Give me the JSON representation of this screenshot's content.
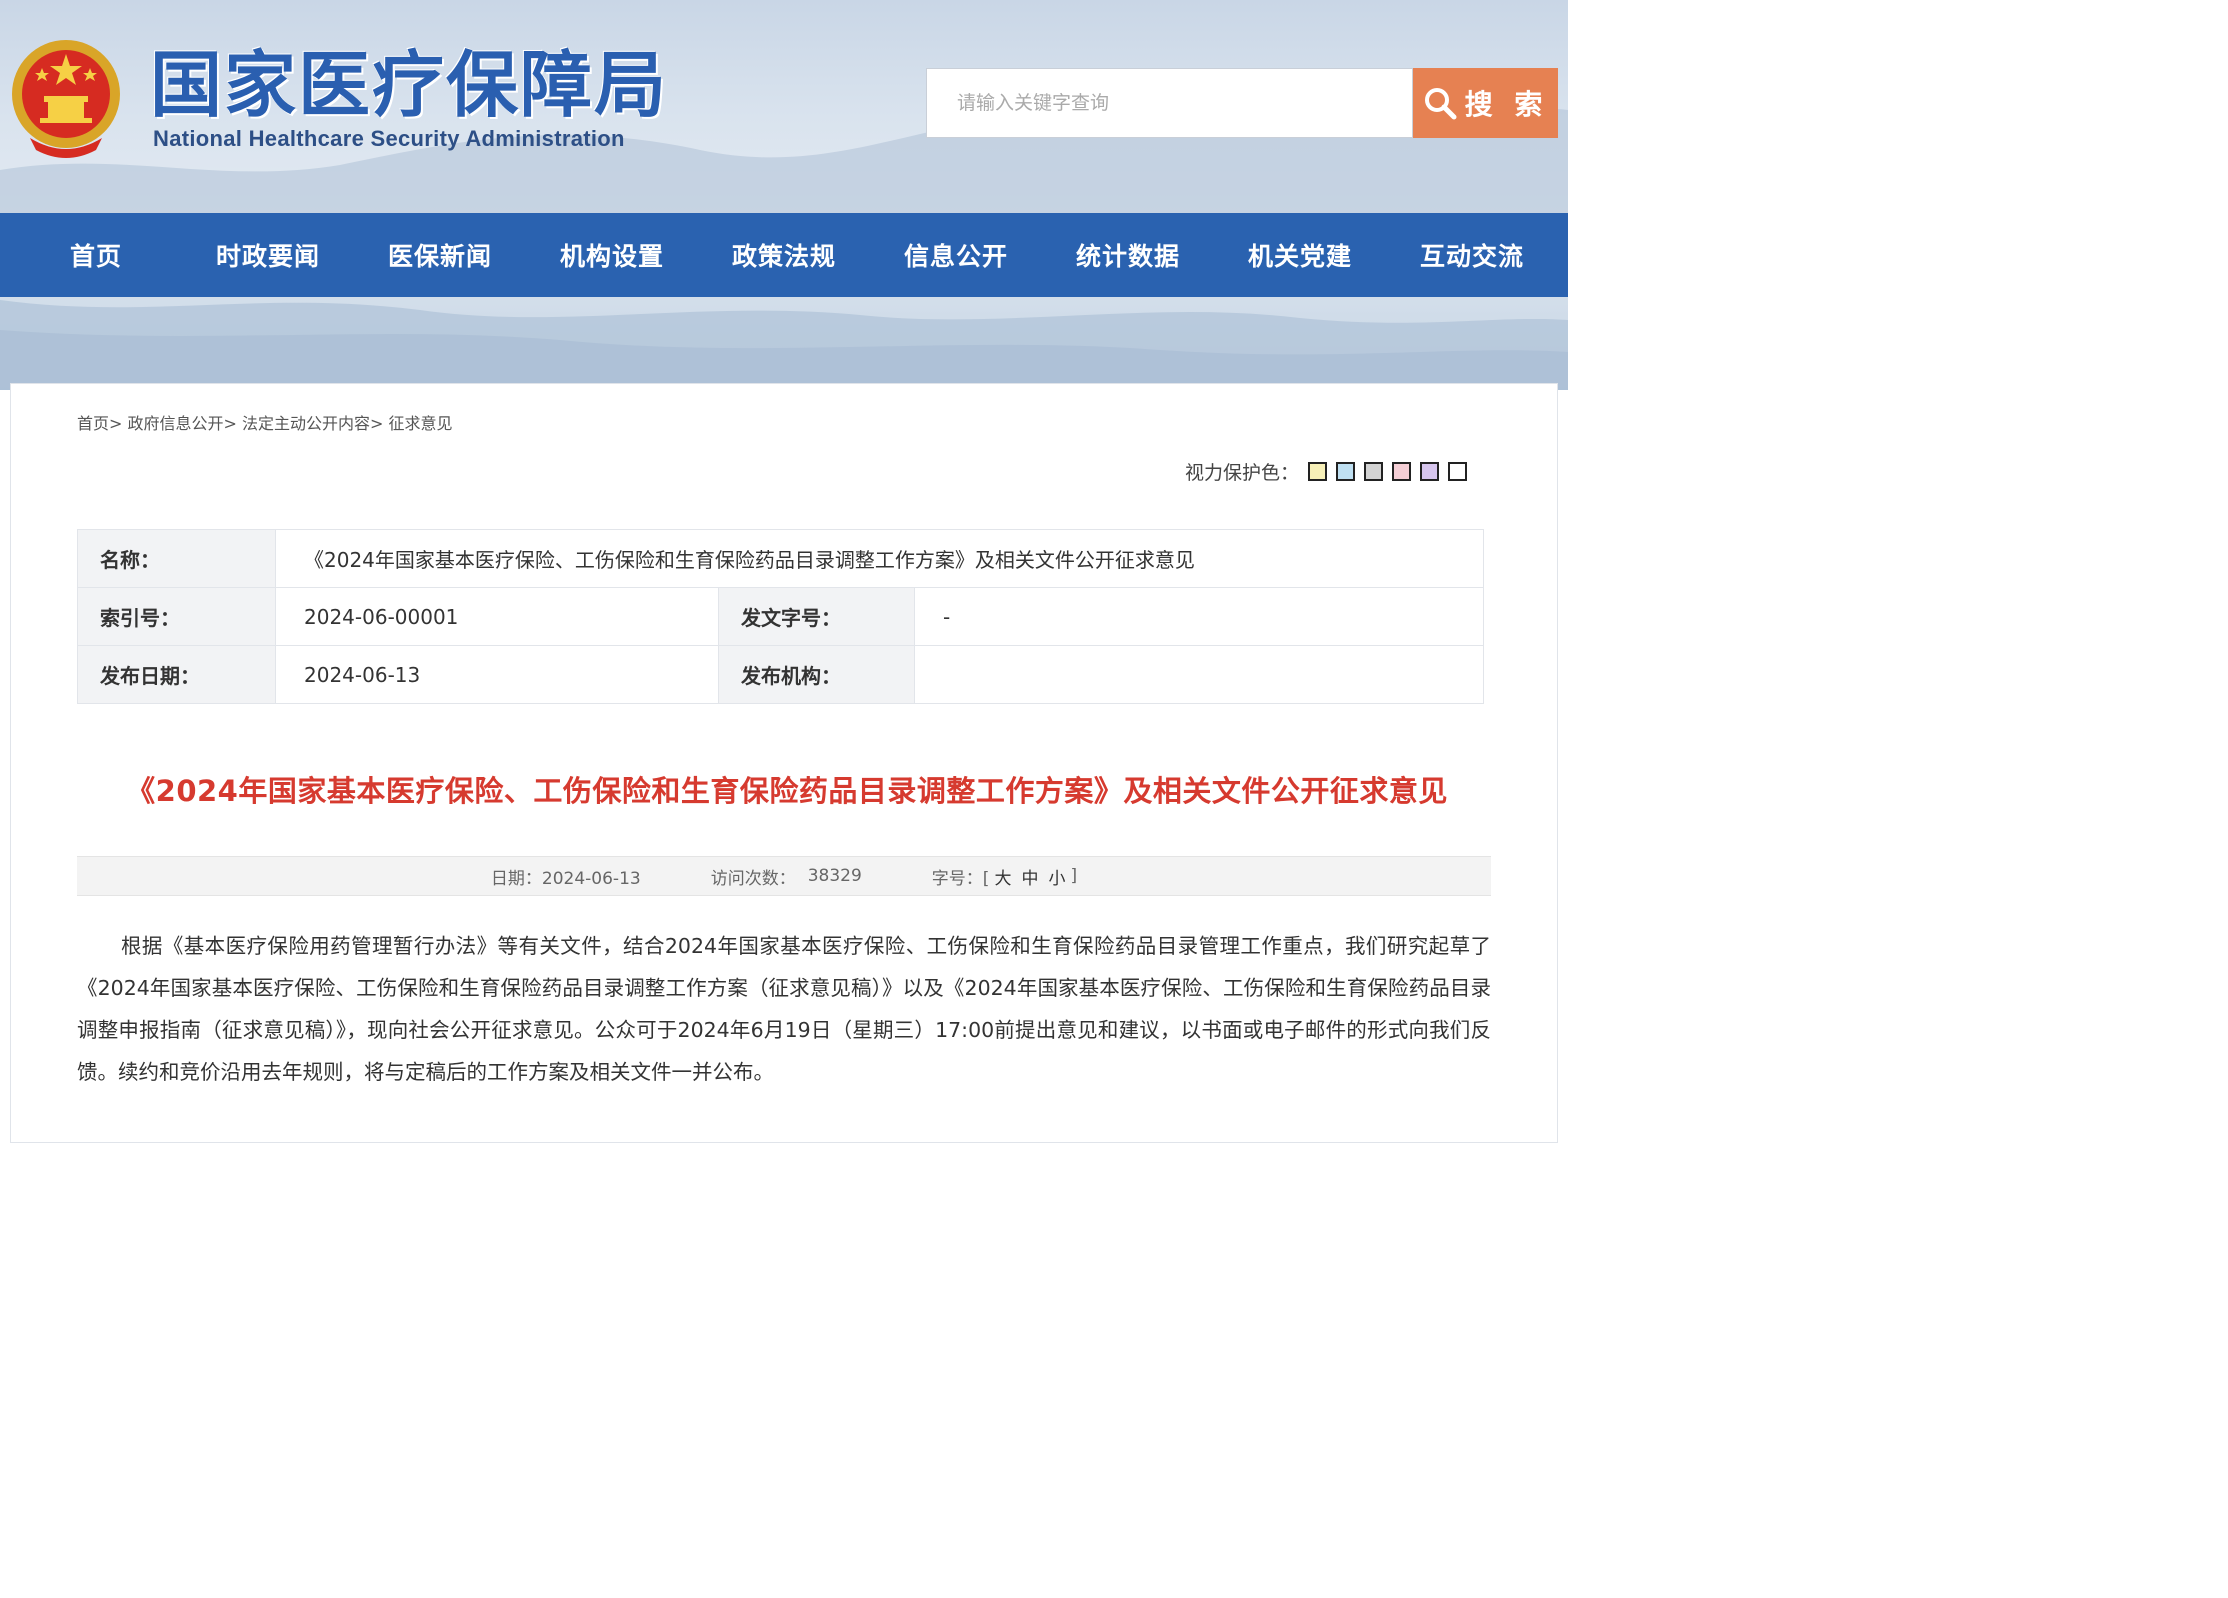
{
  "header": {
    "logo_cn": "国家医疗保障局",
    "logo_en": "National Healthcare Security Administration",
    "emblem_icon": "national-emblem-icon"
  },
  "search": {
    "placeholder": "请输入关键字查询",
    "button_label": "搜 索",
    "icon": "search-icon"
  },
  "nav": {
    "items": [
      "首页",
      "时政要闻",
      "医保新闻",
      "机构设置",
      "政策法规",
      "信息公开",
      "统计数据",
      "机关党建",
      "互动交流"
    ]
  },
  "breadcrumb": {
    "items": [
      "首页>",
      "政府信息公开>",
      "法定主动公开内容>",
      "征求意见"
    ]
  },
  "eye_care": {
    "label": "视力保护色：",
    "swatches": [
      "#f7f0b8",
      "#bfe0f2",
      "#d3d3d3",
      "#f5cfd6",
      "#d7c6ee",
      "#ffffff"
    ]
  },
  "info": {
    "name_label": "名称：",
    "name_value": "《2024年国家基本医疗保险、工伤保险和生育保险药品目录调整工作方案》及相关文件公开征求意见",
    "index_label": "索引号：",
    "index_value": "2024-06-00001",
    "docno_label": "发文字号：",
    "docno_value": "-",
    "date_label": "发布日期：",
    "date_value": "2024-06-13",
    "org_label": "发布机构：",
    "org_value": ""
  },
  "article": {
    "title": "《2024年国家基本医疗保险、工伤保险和生育保险药品目录调整工作方案》及相关文件公开征求意见",
    "meta_date": "日期：2024-06-13",
    "meta_visits_label": "访问次数：",
    "meta_visits": "38329",
    "meta_fontsize_label": "字号：[",
    "fs_large": "大",
    "fs_medium": "中",
    "fs_small": "小",
    "meta_fontsize_end": "]",
    "body": "根据《基本医疗保险用药管理暂行办法》等有关文件，结合2024年国家基本医疗保险、工伤保险和生育保险药品目录管理工作重点，我们研究起草了《2024年国家基本医疗保险、工伤保险和生育保险药品目录调整工作方案（征求意见稿）》以及《2024年国家基本医疗保险、工伤保险和生育保险药品目录调整申报指南（征求意见稿）》，现向社会公开征求意见。公众可于2024年6月19日（星期三）17:00前提出意见和建议，以书面或电子邮件的形式向我们反馈。续约和竞价沿用去年规则，将与定稿后的工作方案及相关文件一并公布。"
  },
  "colors": {
    "nav_bg": "#2a62b0",
    "search_btn": "#e68152",
    "title_red": "#d63a2f",
    "logo_blue": "#2a5fb0"
  }
}
